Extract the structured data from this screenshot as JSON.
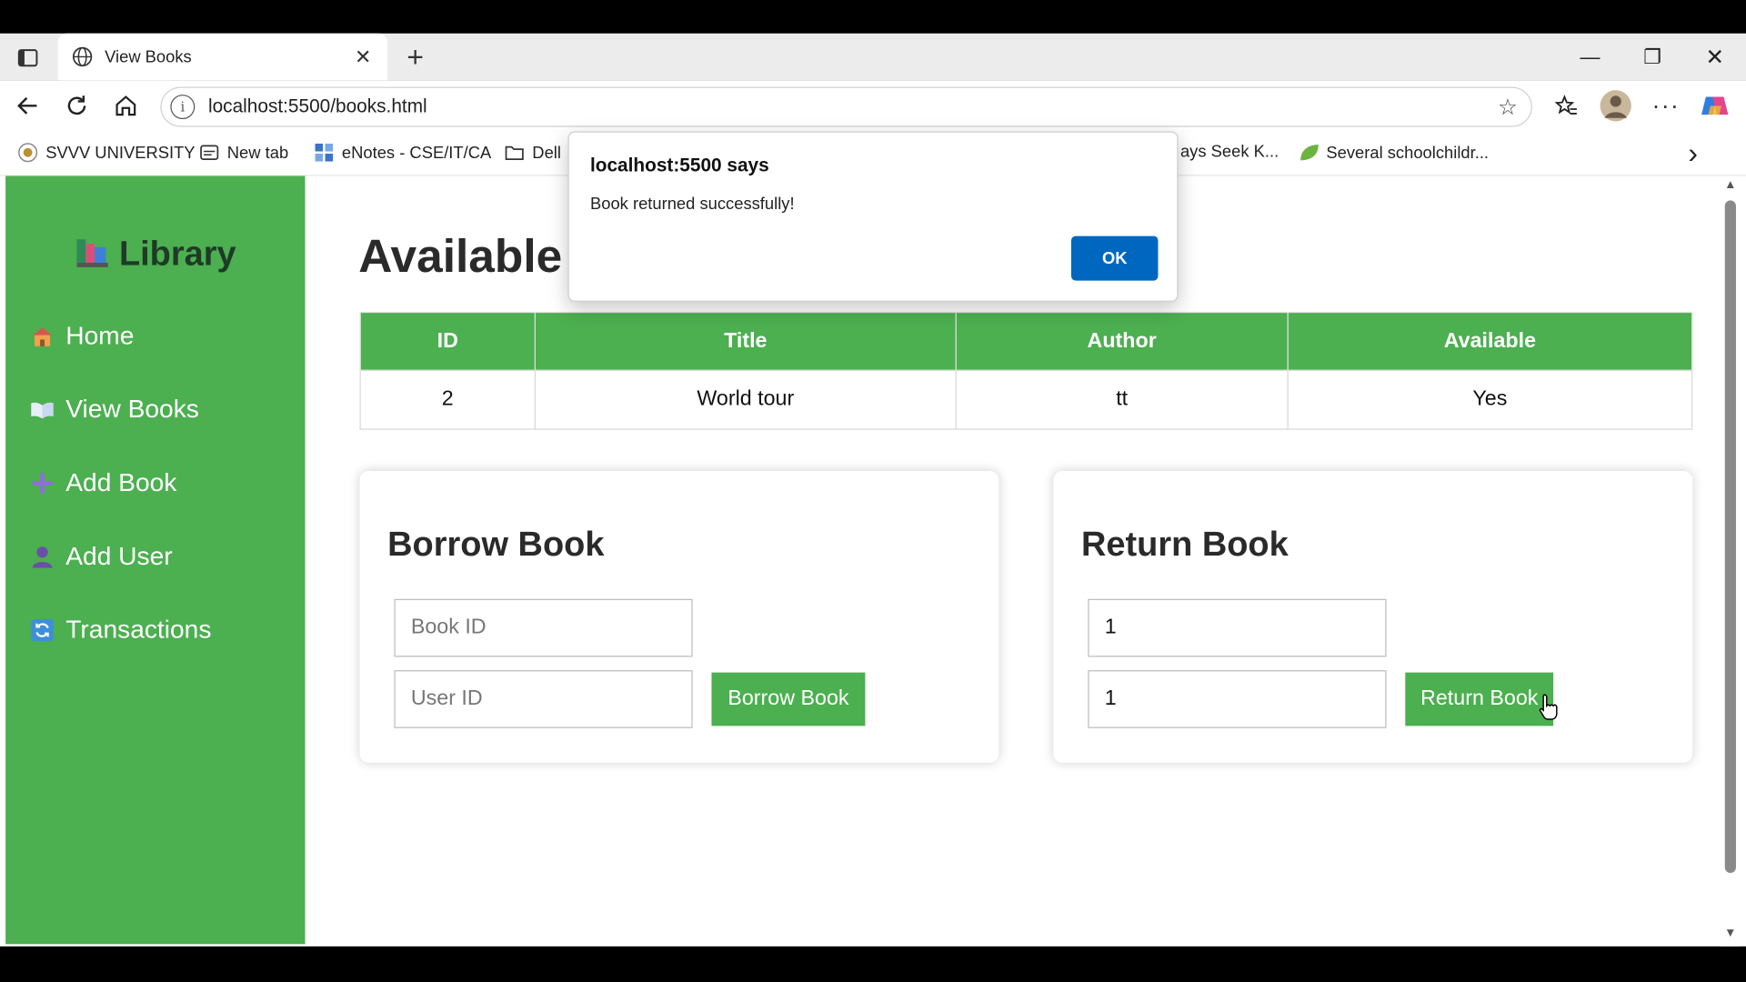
{
  "browser": {
    "tab_title": "View Books",
    "tab_close": "✕",
    "new_tab": "+",
    "url": "localhost:5500/books.html",
    "info_glyph": "i",
    "star_glyph": "☆",
    "window_controls": {
      "minimize": "—",
      "restore": "❐",
      "close": "✕"
    },
    "bookmarks": [
      {
        "label": "SVVV UNIVERSITY",
        "icon": "university-icon"
      },
      {
        "label": "New tab",
        "icon": "newtab-icon"
      },
      {
        "label": "eNotes - CSE/IT/CA",
        "icon": "enotes-icon"
      },
      {
        "label": "Dell",
        "icon": "folder-icon"
      },
      {
        "label": "ays Seek K...",
        "icon": "none"
      },
      {
        "label": "Several schoolchildr...",
        "icon": "leaf-icon"
      }
    ],
    "more_glyph": "›"
  },
  "sidebar": {
    "brand": "Library",
    "items": [
      {
        "label": "Home",
        "icon": "house-icon"
      },
      {
        "label": "View Books",
        "icon": "open-book-icon"
      },
      {
        "label": "Add Book",
        "icon": "plus-icon"
      },
      {
        "label": "Add User",
        "icon": "user-icon"
      },
      {
        "label": "Transactions",
        "icon": "refresh-icon"
      }
    ]
  },
  "main": {
    "title": "Available Books",
    "table": {
      "headers": [
        "ID",
        "Title",
        "Author",
        "Available"
      ],
      "rows": [
        [
          "2",
          "World tour",
          "tt",
          "Yes"
        ]
      ]
    },
    "borrow": {
      "heading": "Borrow Book",
      "book_id_placeholder": "Book ID",
      "book_id_value": "",
      "user_id_placeholder": "User ID",
      "user_id_value": "",
      "button": "Borrow Book"
    },
    "return": {
      "heading": "Return Book",
      "book_id_value": "1",
      "user_id_value": "1",
      "button": "Return Book"
    }
  },
  "dialog": {
    "title": "localhost:5500 says",
    "message": "Book returned successfully!",
    "ok": "OK"
  },
  "colors": {
    "accent_green": "#4caf50",
    "dialog_button": "#0067c0"
  }
}
